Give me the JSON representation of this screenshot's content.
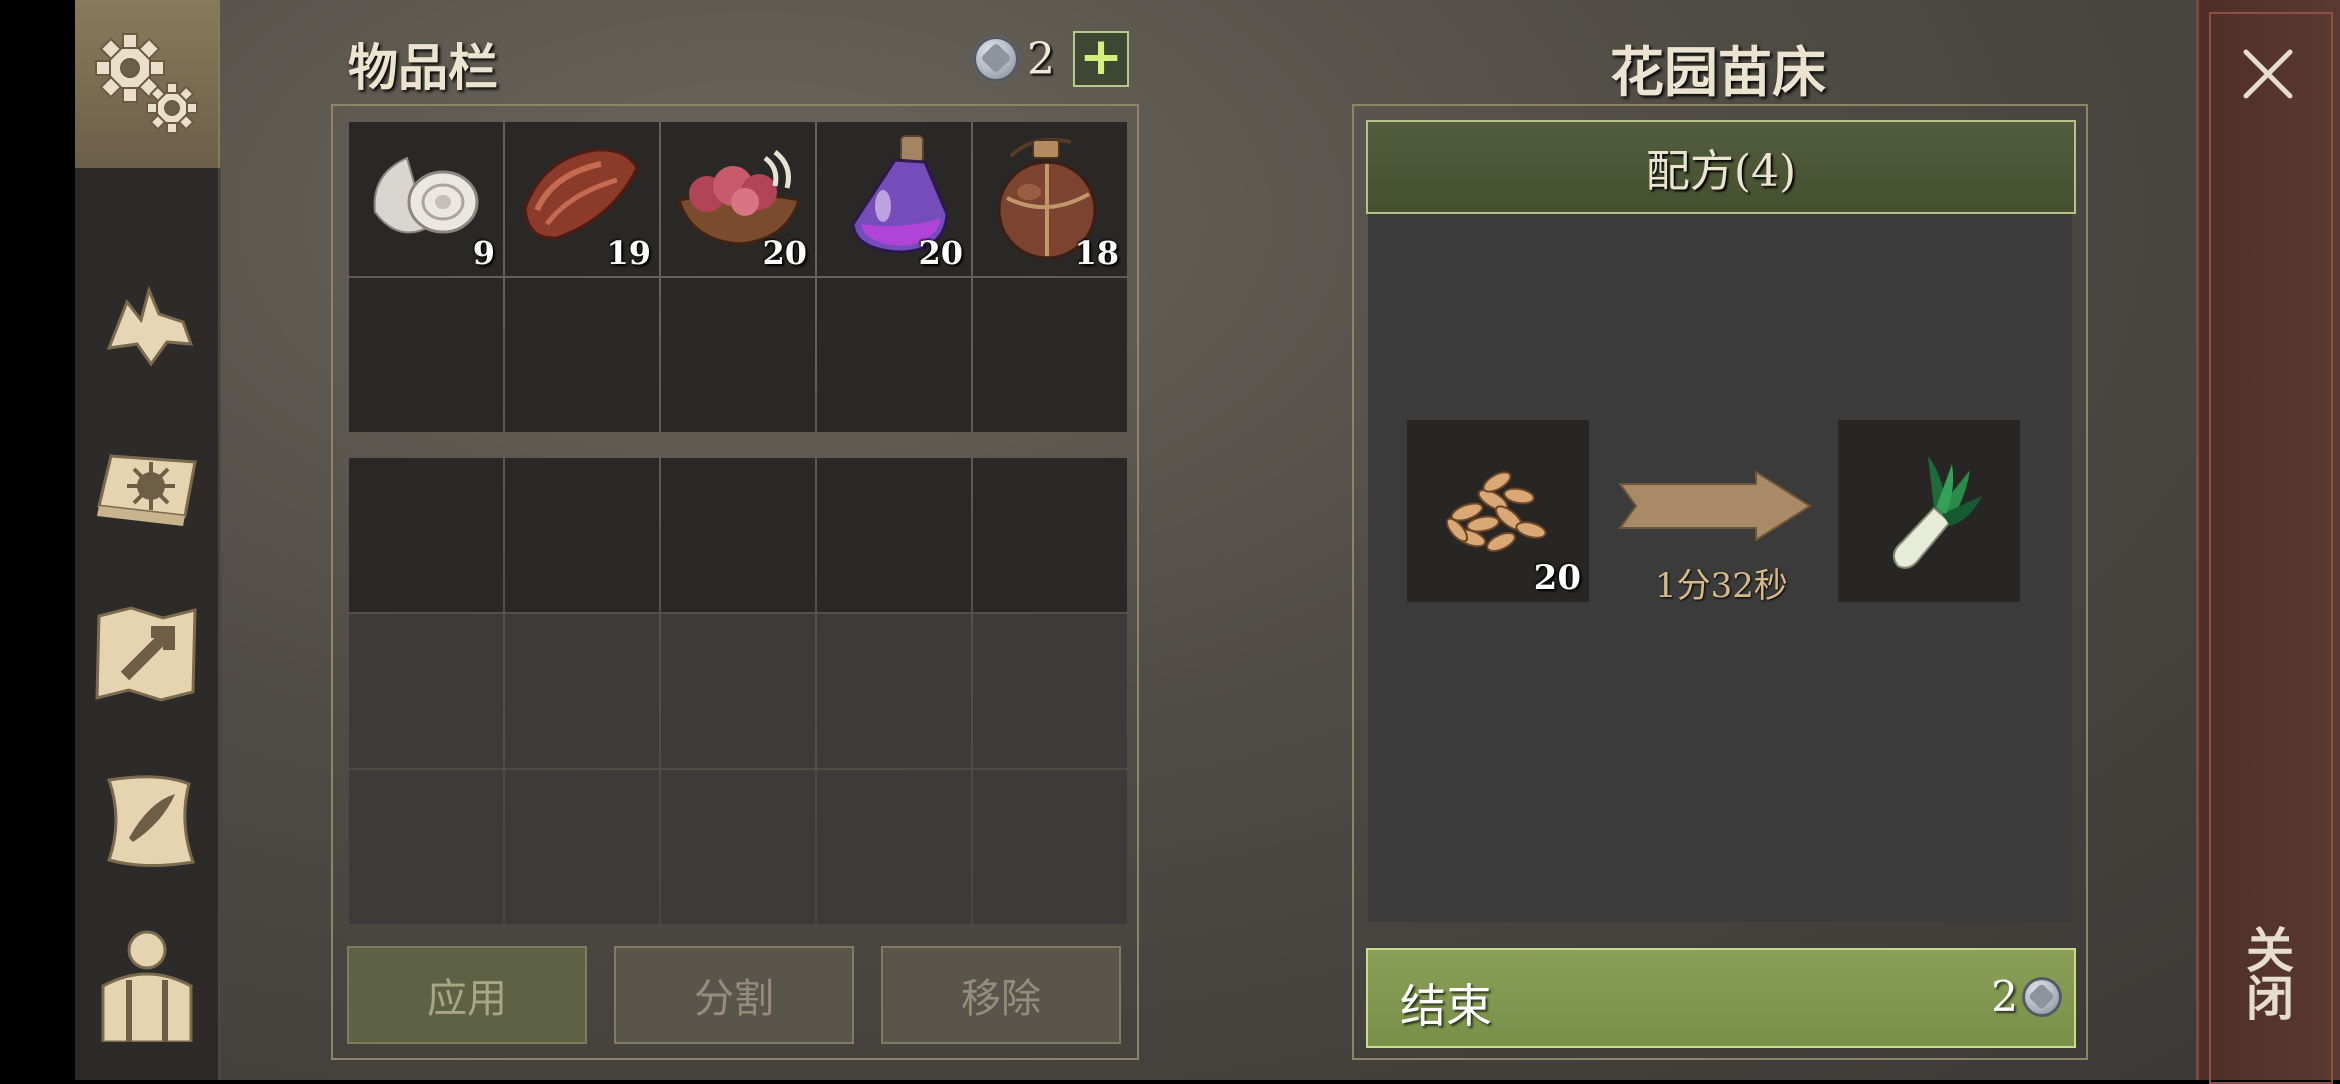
{
  "inventory": {
    "title": "物品栏",
    "currency": "2",
    "items": [
      {
        "icon": "bandage-roll-icon",
        "qty": "9"
      },
      {
        "icon": "raw-meat-icon",
        "qty": "19"
      },
      {
        "icon": "meat-bowl-icon",
        "qty": "20"
      },
      {
        "icon": "purple-potion-icon",
        "qty": "20"
      },
      {
        "icon": "leather-flask-icon",
        "qty": "18"
      }
    ],
    "buttons": {
      "apply": "应用",
      "split": "分割",
      "remove": "移除"
    }
  },
  "garden_bed": {
    "title": "花园苗床",
    "recipes_tab": "配方(4)",
    "input": {
      "icon": "seeds-icon",
      "qty": "20"
    },
    "output": {
      "icon": "leek-icon"
    },
    "timer": "1分32秒",
    "finish": {
      "label": "结束",
      "cost": "2"
    }
  },
  "close": {
    "label": "关闭"
  },
  "colors": {
    "accent_green": "#8a9f57",
    "close_panel": "#4e2e26"
  }
}
